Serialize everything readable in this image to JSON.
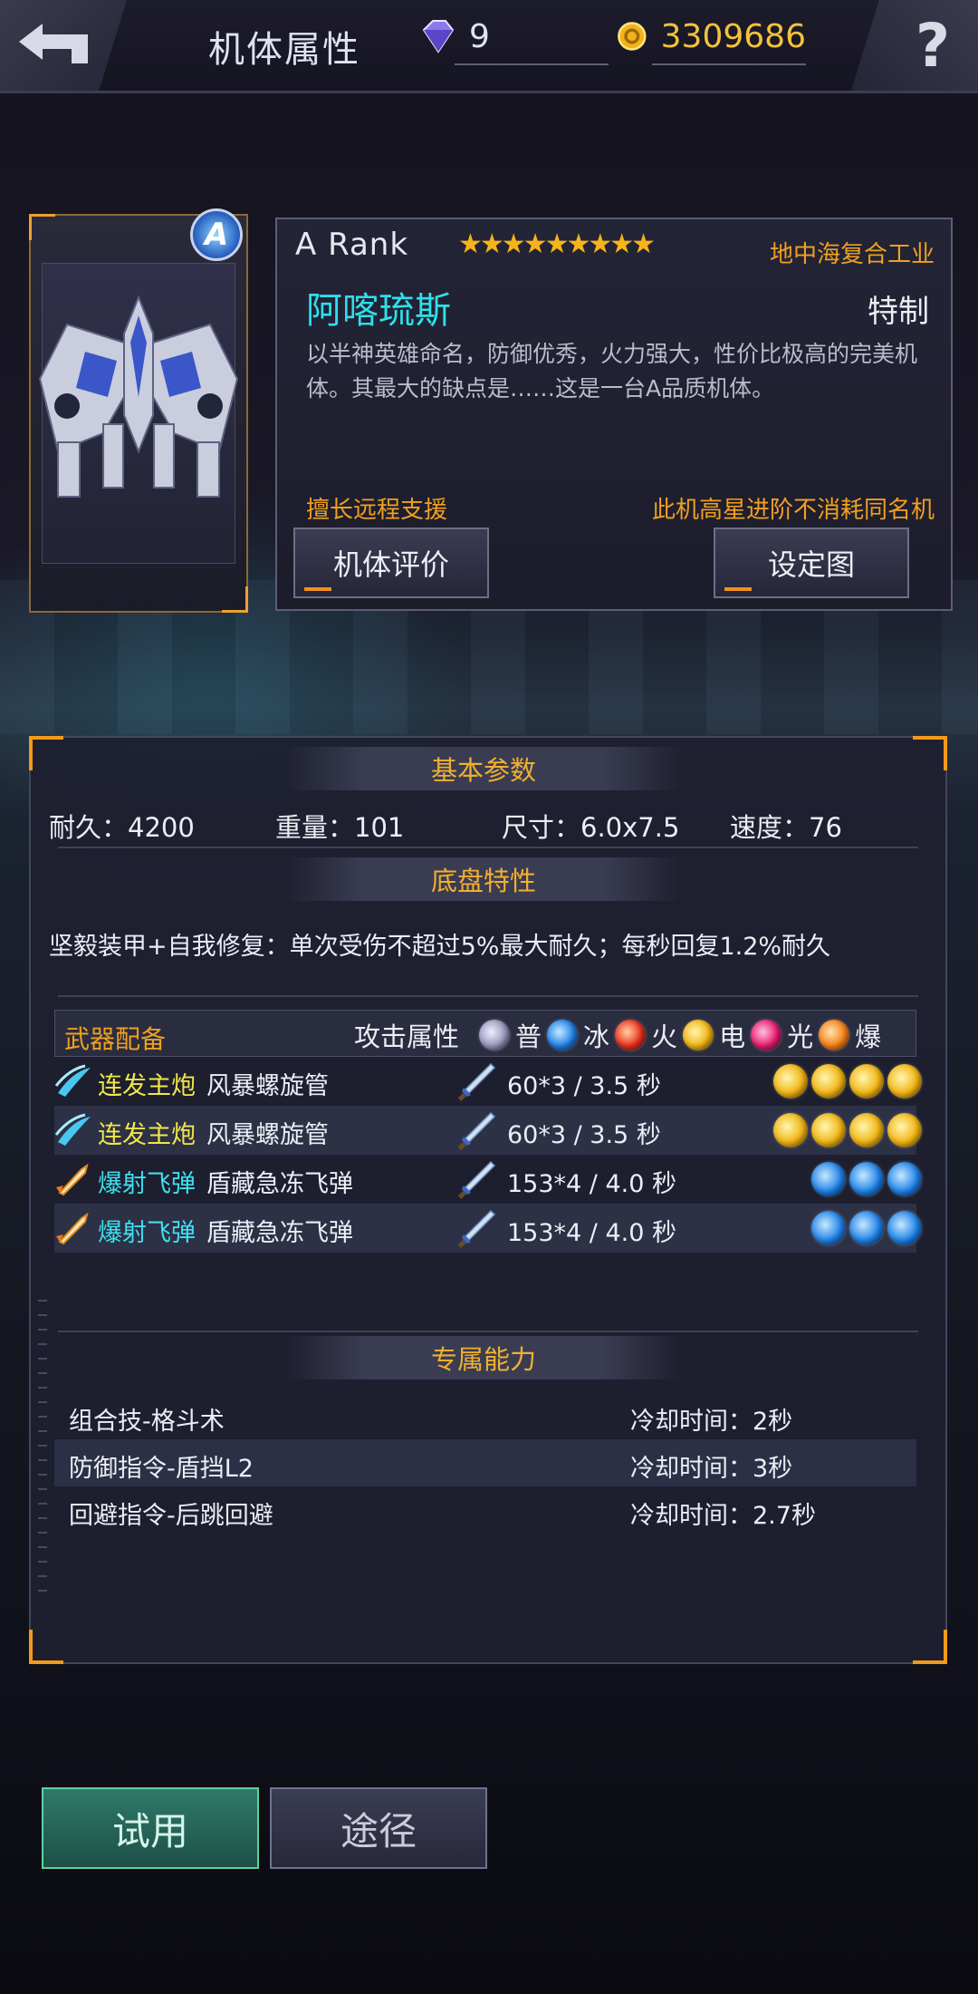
{
  "header": {
    "title": "机体属性",
    "gems": "9",
    "coins": "3309686",
    "help_symbol": "?"
  },
  "mech": {
    "rank_badge": "A",
    "rank": "A  Rank",
    "stars": "★★★★★★★★★",
    "star_count": 9,
    "maker": "地中海复合工业",
    "name": "阿喀琉斯",
    "type": "特制",
    "description": "以半神英雄命名，防御优秀，火力强大，性价比极高的完美机体。其最大的缺点是……这是一台A品质机体。",
    "specialty": "擅长远程支援",
    "note": "此机高星进阶不消耗同名机",
    "eval_button": "机体评价",
    "art_button": "设定图"
  },
  "basic": {
    "header": "基本参数",
    "stats": [
      {
        "label": "耐久：4200"
      },
      {
        "label": "重量：101"
      },
      {
        "label": "尺寸：6.0x7.5"
      },
      {
        "label": "速度：76"
      }
    ]
  },
  "chassis": {
    "header": "底盘特性",
    "text": "坚毅装甲+自我修复：单次受伤不超过5%最大耐久；每秒回复1.2%耐久"
  },
  "weapons": {
    "label": "武器配备",
    "attr_label": "攻击属性",
    "attrs": [
      "普",
      "冰",
      "火",
      "电",
      "光",
      "爆"
    ],
    "items": [
      {
        "type": "连发主炮",
        "type_color": "#f2e64a",
        "name": "风暴螺旋管",
        "damage": "60*3 / 3.5 秒",
        "element": "elec",
        "level": 4
      },
      {
        "type": "连发主炮",
        "type_color": "#f2e64a",
        "name": "风暴螺旋管",
        "damage": "60*3 / 3.5 秒",
        "element": "elec",
        "level": 4
      },
      {
        "type": "爆射飞弹",
        "type_color": "#3ee0ee",
        "name": "盾藏急冻飞弹",
        "damage": "153*4 / 4.0 秒",
        "element": "ice",
        "level": 3
      },
      {
        "type": "爆射飞弹",
        "type_color": "#3ee0ee",
        "name": "盾藏急冻飞弹",
        "damage": "153*4 / 4.0 秒",
        "element": "ice",
        "level": 3
      }
    ]
  },
  "abilities": {
    "header": "专属能力",
    "items": [
      {
        "name": "组合技-格斗术",
        "cooldown": "冷却时间：2秒"
      },
      {
        "name": "防御指令-盾挡L2",
        "cooldown": "冷却时间：3秒"
      },
      {
        "name": "回避指令-后跳回避",
        "cooldown": "冷却时间：2.7秒"
      }
    ]
  },
  "footer": {
    "try_button": "试用",
    "route_button": "途径"
  }
}
